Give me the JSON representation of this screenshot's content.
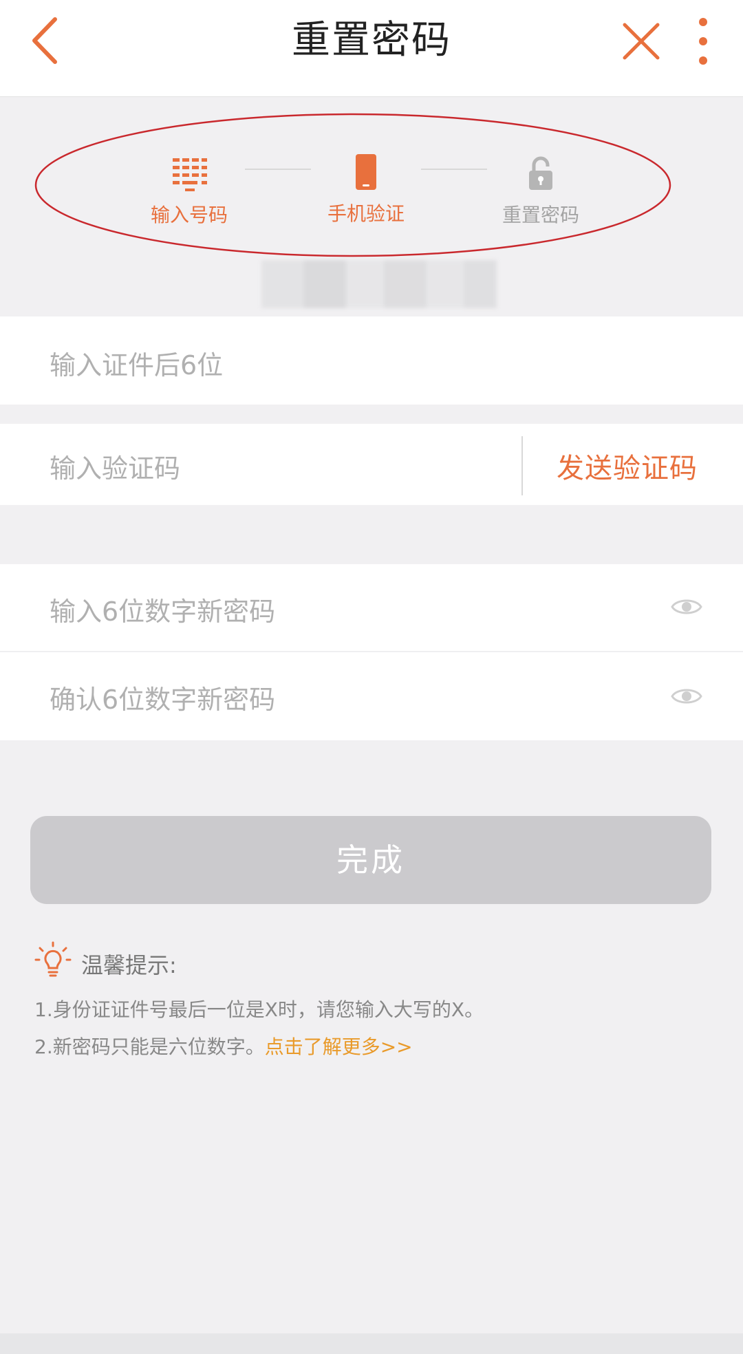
{
  "header": {
    "title": "重置密码",
    "back_icon": "chevron-left-icon",
    "close_icon": "close-icon",
    "more_icon": "more-vertical-icon",
    "accent_color": "#e8703d"
  },
  "steps": [
    {
      "label": "输入号码",
      "icon": "keypad-icon",
      "state": "done"
    },
    {
      "label": "手机验证",
      "icon": "phone-icon",
      "state": "active"
    },
    {
      "label": "重置密码",
      "icon": "lock-icon",
      "state": "pending"
    }
  ],
  "form": {
    "id_placeholder": "输入证件后6位",
    "code_placeholder": "输入验证码",
    "send_code_label": "发送验证码",
    "new_password_placeholder": "输入6位数字新密码",
    "confirm_password_placeholder": "确认6位数字新密码"
  },
  "done_button": {
    "label": "完成"
  },
  "tips": {
    "title": "温馨提示:",
    "line1": "1.身份证证件号最后一位是X时，请您输入大写的X。",
    "line2_prefix": "2.新密码只能是六位数字。",
    "learn_more": "点击了解更多>>",
    "learn_more_color": "#e99a2a"
  }
}
